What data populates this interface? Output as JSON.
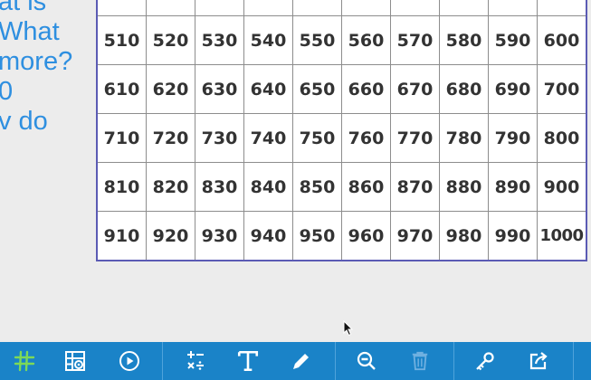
{
  "prompt_lines": [
    "at is",
    "What",
    "more?",
    "0",
    "v do"
  ],
  "hundreds_chart": {
    "rows": [
      [
        "",
        "",
        "",
        "",
        "",
        "",
        "",
        "",
        "",
        ""
      ],
      [
        "510",
        "520",
        "530",
        "540",
        "550",
        "560",
        "570",
        "580",
        "590",
        "600"
      ],
      [
        "610",
        "620",
        "630",
        "640",
        "650",
        "660",
        "670",
        "680",
        "690",
        "700"
      ],
      [
        "710",
        "720",
        "730",
        "740",
        "750",
        "760",
        "770",
        "780",
        "790",
        "800"
      ],
      [
        "810",
        "820",
        "830",
        "840",
        "850",
        "860",
        "870",
        "880",
        "890",
        "900"
      ],
      [
        "910",
        "920",
        "930",
        "940",
        "950",
        "960",
        "970",
        "980",
        "990",
        "1000"
      ]
    ]
  },
  "toolbar": {
    "tools": [
      "grid-icon",
      "grid-settings-icon",
      "play-icon",
      "operations-icon",
      "text-icon",
      "pen-icon",
      "zoom-out-icon",
      "trash-icon",
      "key-icon",
      "share-icon"
    ]
  },
  "colors": {
    "toolbar_bg": "#1a83c8",
    "prompt_text": "#2e8fe0",
    "grid_border": "#5b5bb4",
    "active_tool": "#7dd957",
    "disabled_tool": "#6fb0e0"
  }
}
